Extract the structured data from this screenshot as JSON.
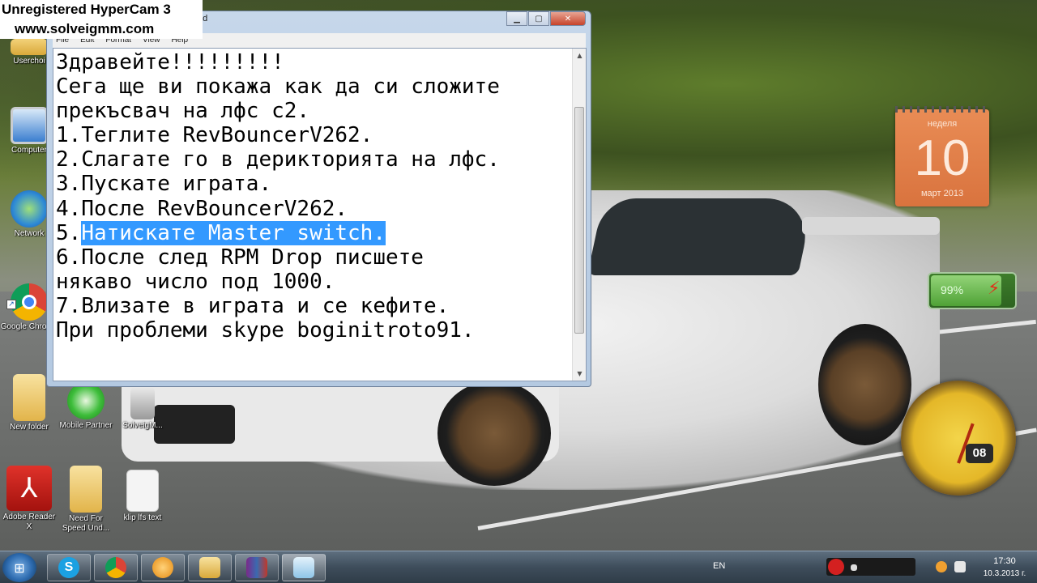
{
  "watermark": {
    "line1": "Unregistered HyperCam 3",
    "line2": "www.solveigmm.com"
  },
  "desktop_icons": [
    {
      "label": "Userchoi",
      "icon": "user-folder-icon"
    },
    {
      "label": "Computer",
      "icon": "computer-icon"
    },
    {
      "label": "Network",
      "icon": "network-icon"
    },
    {
      "label": "Google Chrome",
      "icon": "chrome-icon"
    },
    {
      "label": "New folder",
      "icon": "folder-icon"
    },
    {
      "label": "Mobile Partner",
      "icon": "mobile-partner-icon"
    },
    {
      "label": "SolveigM...",
      "icon": "solveigmm-icon"
    },
    {
      "label": "Adobe Reader X",
      "icon": "adobe-reader-icon"
    },
    {
      "label": "Need For Speed Und...",
      "icon": "folder-icon"
    },
    {
      "label": "klip lfs text",
      "icon": "text-file-icon"
    }
  ],
  "notepad": {
    "title": "ad",
    "menu": [
      "File",
      "Edit",
      "Format",
      "View",
      "Help"
    ],
    "lines": [
      "Здравейте!!!!!!!!!",
      "Сега ще ви покажа как да си сложите",
      "прекъсвач на лфс с2.",
      "1.Теглите RevBouncerV262.",
      "2.Слагате го в дерикторията на лфс.",
      "3.Пускате играта.",
      "4.После RevBouncerV262."
    ],
    "line5_prefix": "5.",
    "line5_selected": "Натискате Master switch.",
    "lines_after": [
      "6.После след RPM Drop писшете",
      "някаво число под 1000.",
      "7.Влизате в играта и се кефите.",
      "При проблеми skype boginitroto91."
    ]
  },
  "calendar": {
    "weekday": "неделя",
    "day": "10",
    "month_year": "март 2013"
  },
  "battery": {
    "percent_label": "99%",
    "level": 0.99
  },
  "clock_gadget": {
    "badge": "08"
  },
  "taskbar": {
    "apps": [
      "start-icon",
      "skype-icon",
      "chrome-icon",
      "media-player-icon",
      "explorer-icon",
      "winrar-icon",
      "notepad-icon"
    ],
    "language": "EN",
    "time": "17:30",
    "date": "10.3.2013 г."
  },
  "colors": {
    "selection": "#3399ff",
    "calendar": "#e2804a",
    "taskbar": "#3e4d5b"
  }
}
